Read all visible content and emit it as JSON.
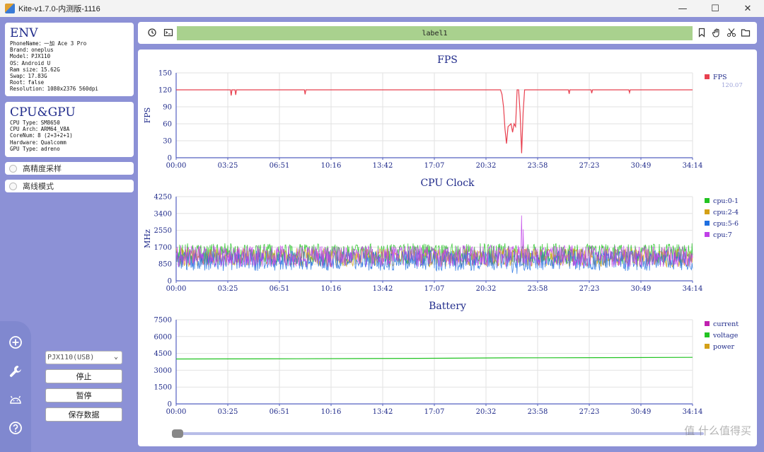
{
  "window": {
    "title": "Kite-v1.7.0-内测版-1116",
    "minimize": "—",
    "maximize": "☐",
    "close": "✕"
  },
  "sidebar": {
    "env": {
      "title": "ENV",
      "lines": [
        "PhoneName：一加 Ace 3 Pro",
        "Brand：oneplus",
        "Model：PJX110",
        "OS：Android U",
        "Ram size：15.62G",
        "Swap：17.83G",
        "Root：false",
        "Resolution：1080x2376 560dpi"
      ]
    },
    "cpugpu": {
      "title": "CPU&GPU",
      "lines": [
        "CPU Type：SM8650",
        "CPU Arch：ARM64_V8A",
        "CoreNum：8 (2+3+2+1)",
        "Hardware：Qualcomm",
        "GPU Type：adreno"
      ]
    },
    "toggles": [
      "高精度采样",
      "离线模式"
    ],
    "device": "PJX110(USB)",
    "buttons": {
      "stop": "停止",
      "pause": "暂停",
      "save": "保存数据"
    },
    "nav_icons": [
      "plus-circle-icon",
      "wrench-icon",
      "android-icon",
      "help-icon"
    ]
  },
  "toolbar": {
    "label": "label1",
    "left_icons": [
      "refresh-icon",
      "terminal-icon"
    ],
    "right_icons": [
      "bookmark-icon",
      "hand-icon",
      "scissors-icon",
      "folder-icon"
    ]
  },
  "watermark": "值 什么值得买",
  "chart_data": [
    {
      "type": "line",
      "title": "FPS",
      "ylabel": "FPS",
      "ylim": [
        0,
        150
      ],
      "yticks": [
        0,
        30,
        60,
        90,
        120,
        150
      ],
      "xticks": [
        "00:00",
        "03:25",
        "06:51",
        "10:16",
        "13:42",
        "17:07",
        "20:32",
        "23:58",
        "27:23",
        "30:49",
        "34:14"
      ],
      "series": [
        {
          "name": "FPS",
          "color": "#e8404f",
          "legend_sub": "120.07",
          "points": [
            [
              0,
              120
            ],
            [
              1.5,
              120
            ],
            [
              3.6,
              120
            ],
            [
              3.65,
              110
            ],
            [
              3.7,
              120
            ],
            [
              3.9,
              120
            ],
            [
              3.95,
              111
            ],
            [
              4.0,
              120
            ],
            [
              8.5,
              120
            ],
            [
              8.55,
              112
            ],
            [
              8.6,
              120
            ],
            [
              21.5,
              120
            ],
            [
              21.6,
              112
            ],
            [
              21.7,
              90
            ],
            [
              21.8,
              50
            ],
            [
              21.9,
              25
            ],
            [
              22.0,
              55
            ],
            [
              22.2,
              60
            ],
            [
              22.3,
              45
            ],
            [
              22.4,
              60
            ],
            [
              22.5,
              55
            ],
            [
              22.6,
              120
            ],
            [
              22.7,
              120
            ],
            [
              22.8,
              80
            ],
            [
              22.9,
              8
            ],
            [
              23.0,
              80
            ],
            [
              23.1,
              120
            ],
            [
              26.0,
              120
            ],
            [
              26.05,
              113
            ],
            [
              26.1,
              120
            ],
            [
              27.5,
              120
            ],
            [
              27.55,
              114
            ],
            [
              27.6,
              120
            ],
            [
              30.0,
              120
            ],
            [
              30.05,
              115
            ],
            [
              30.1,
              120
            ],
            [
              34.23,
              120
            ]
          ]
        }
      ]
    },
    {
      "type": "line",
      "title": "CPU Clock",
      "ylabel": "MHz",
      "ylim": [
        0,
        4250
      ],
      "yticks": [
        0,
        850,
        1700,
        2550,
        3400,
        4250
      ],
      "xticks": [
        "00:00",
        "03:25",
        "06:51",
        "10:16",
        "13:42",
        "17:07",
        "20:32",
        "23:58",
        "27:23",
        "30:49",
        "34:14"
      ],
      "series": [
        {
          "name": "cpu:0-1",
          "color": "#22c322",
          "range": [
            850,
            1850
          ],
          "points": [
            [
              22.5,
              1800
            ],
            [
              22.9,
              1500
            ]
          ]
        },
        {
          "name": "cpu:2-4",
          "color": "#d4a017",
          "range": [
            700,
            1600
          ],
          "points": []
        },
        {
          "name": "cpu:5-6",
          "color": "#1f6fe0",
          "range": [
            500,
            1500
          ],
          "points": [
            [
              22.3,
              400
            ],
            [
              22.6,
              350
            ]
          ]
        },
        {
          "name": "cpu:7",
          "color": "#c040e8",
          "range": [
            700,
            1750
          ],
          "points": [
            [
              22.9,
              3300
            ],
            [
              23.0,
              2600
            ]
          ]
        }
      ]
    },
    {
      "type": "line",
      "title": "Battery",
      "ylim": [
        0,
        7500
      ],
      "yticks": [
        0,
        1500,
        3000,
        4500,
        6000,
        7500
      ],
      "xticks": [
        "00:00",
        "03:25",
        "06:51",
        "10:16",
        "13:42",
        "17:07",
        "20:32",
        "23:58",
        "27:23",
        "30:49",
        "34:14"
      ],
      "series": [
        {
          "name": "current",
          "color": "#c020b0",
          "points": []
        },
        {
          "name": "voltage",
          "color": "#22c322",
          "points": [
            [
              0,
              4000
            ],
            [
              8,
              4020
            ],
            [
              16,
              4060
            ],
            [
              22,
              4100
            ],
            [
              28,
              4120
            ],
            [
              34.23,
              4150
            ]
          ]
        },
        {
          "name": "power",
          "color": "#d4a017",
          "points": []
        }
      ]
    }
  ]
}
